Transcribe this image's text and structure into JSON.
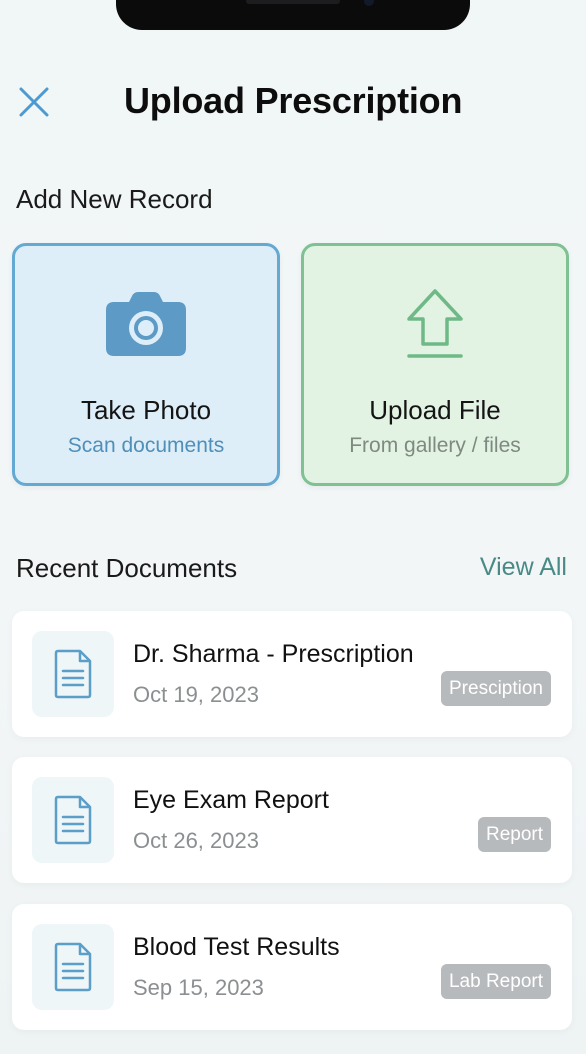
{
  "header": {
    "title": "Upload Prescription",
    "close_icon": "close-icon"
  },
  "add_new": {
    "title": "Add New Record",
    "take_photo": {
      "label": "Take Photo",
      "sub": "Scan documents",
      "icon": "camera-icon",
      "border_color": "#64a9d2",
      "bg_color": "#deeef8"
    },
    "upload_file": {
      "label": "Upload File",
      "sub": "From gallery / files",
      "icon": "upload-arrow-icon",
      "border_color": "#7fc192",
      "bg_color": "#e2f3e3"
    }
  },
  "recent": {
    "title": "Recent Documents",
    "view_all": "View All",
    "items": [
      {
        "title": "Dr. Sharma - Prescription",
        "date": "Oct 19, 2023",
        "badge": "Presciption",
        "icon": "document-icon"
      },
      {
        "title": "Eye Exam Report",
        "date": "Oct 26, 2023",
        "badge": "Report",
        "icon": "document-icon"
      },
      {
        "title": "Blood Test Results",
        "date": "Sep 15, 2023",
        "badge": "Lab Report",
        "icon": "document-icon"
      }
    ]
  },
  "colors": {
    "accent_teal": "#4a8a86",
    "badge_gray": "#b7babc",
    "close_blue": "#4c9ad0"
  }
}
